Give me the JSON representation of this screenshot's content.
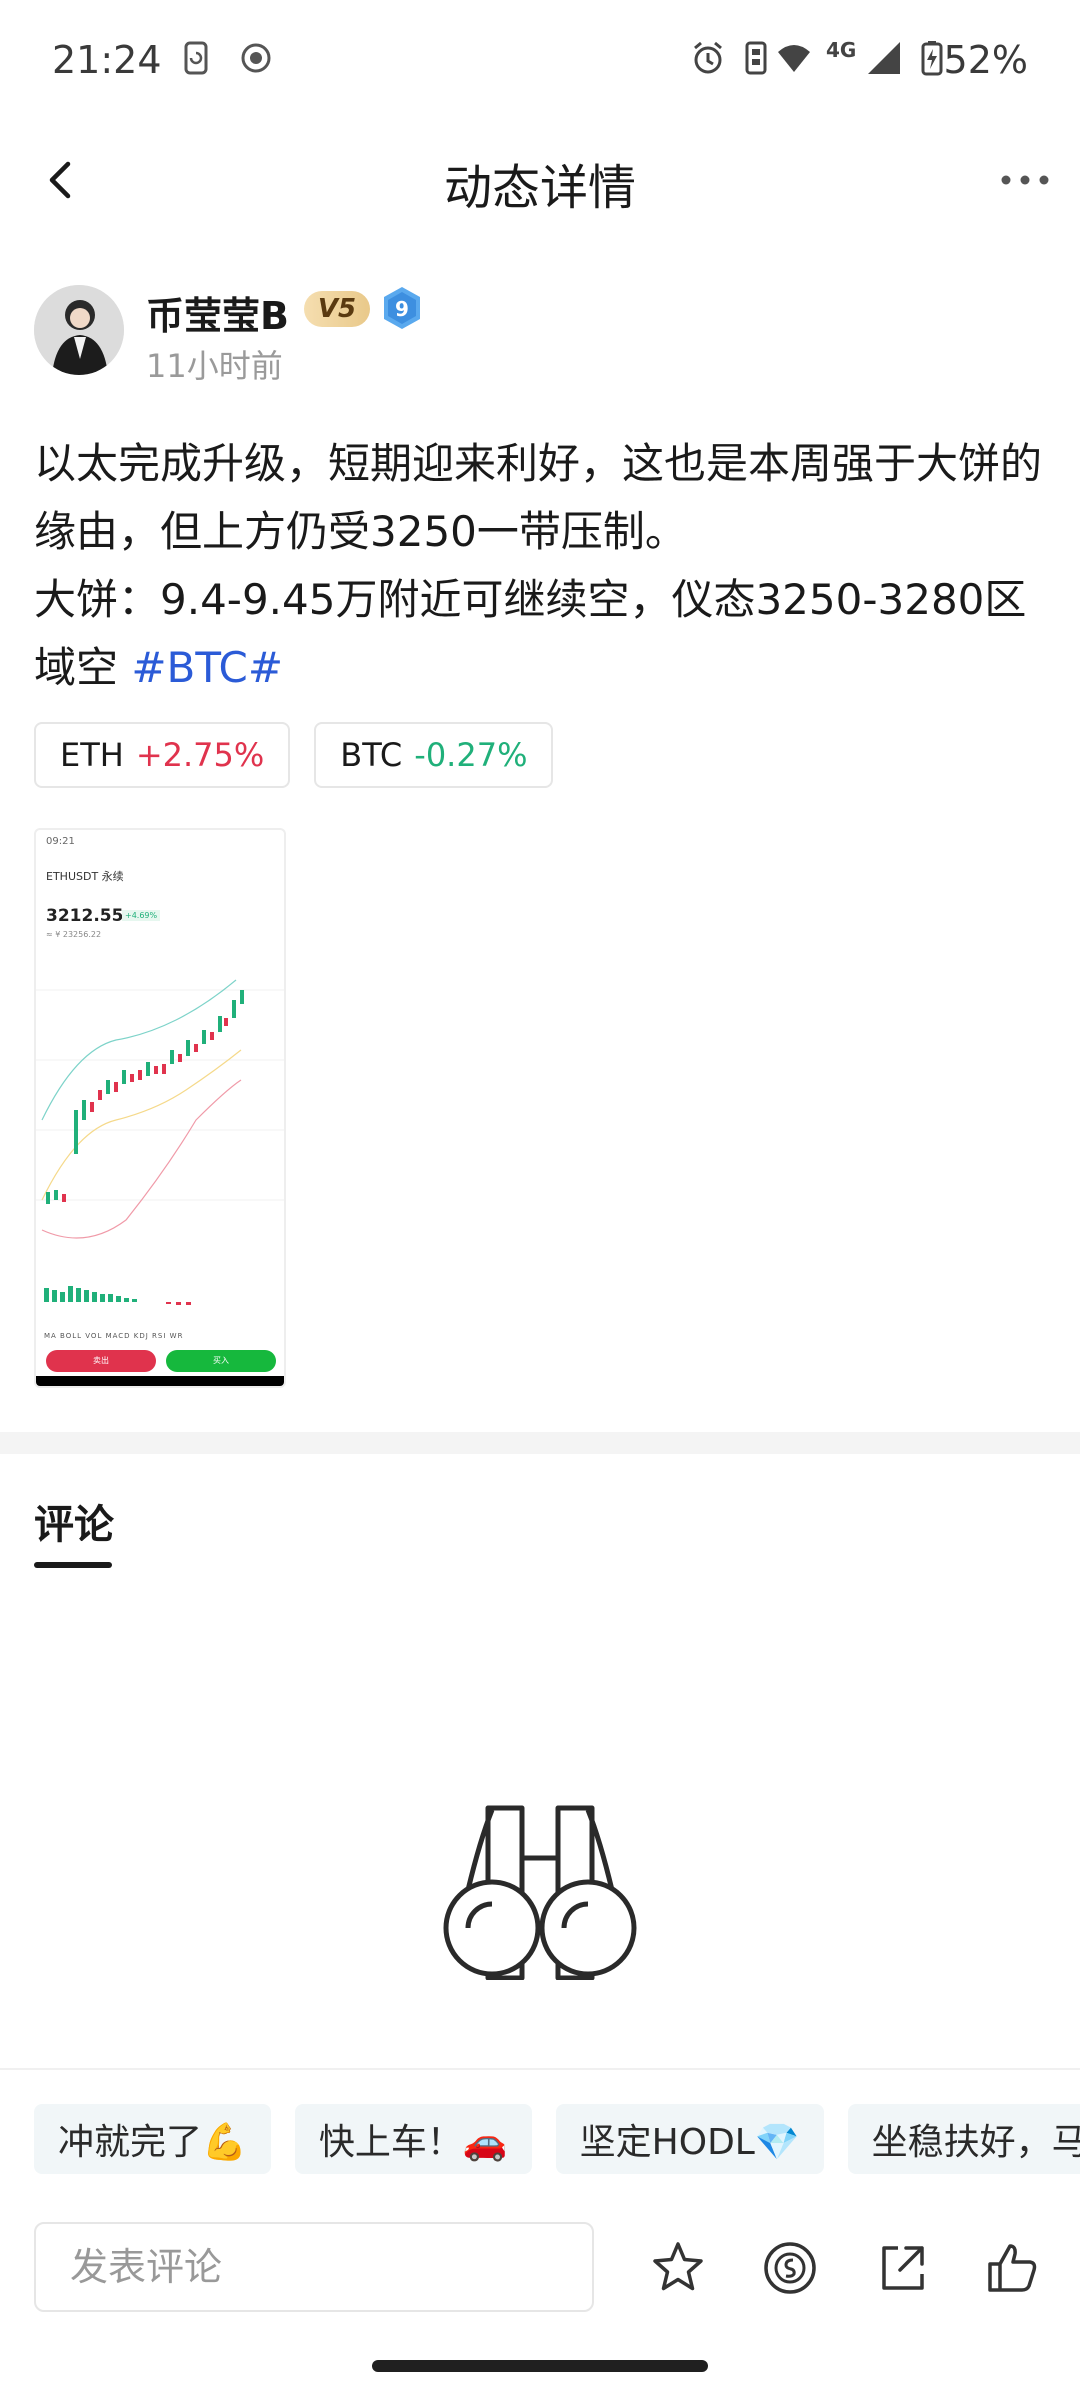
{
  "status_bar": {
    "time": "21:24",
    "battery": "52%",
    "network": "4G",
    "icons": [
      "phone-sync-icon",
      "record-icon",
      "alarm-icon",
      "vibrate-icon",
      "wifi-icon",
      "signal-icon",
      "battery-icon"
    ]
  },
  "header": {
    "title": "动态详情",
    "back_icon": "chevron-left-icon",
    "more_icon": "more-dots-icon"
  },
  "author": {
    "name": "币莹莹B",
    "vip": "V5",
    "level": "9",
    "time": "11小时前"
  },
  "post": {
    "line1": "以太完成升级，短期迎来利好，这也是本周强于大饼的缘由，但上方仍受3250一带压制。",
    "line2_prefix": "大饼：9.4-9.45万附近可继续空，仪态3250-3280区域空 ",
    "hashtag": "#BTC#"
  },
  "coins": [
    {
      "name": "ETH",
      "change": "+2.75%"
    },
    {
      "name": "BTC",
      "change": "-0.27%"
    }
  ],
  "thumbnail": {
    "time": "09:21",
    "pair": "ETHUSDT 永续",
    "price": "3212.55",
    "change": "+4.69%",
    "fiat": "≈ ¥ 23256.22",
    "tabs": "MA  BOLL  VOL  MACD  KDJ  RSI  WR",
    "sell": "卖出",
    "buy": "买入"
  },
  "comments": {
    "tab_label": "评论",
    "empty_icon": "binoculars-icon"
  },
  "quick_replies": [
    "冲就完了💪",
    "快上车！🚗",
    "坚定HODL💎",
    "坐稳扶好，马"
  ],
  "bottom_bar": {
    "input_placeholder": "发表评论",
    "actions": [
      "star-icon",
      "coin-tip-icon",
      "share-icon",
      "like-icon"
    ]
  },
  "colors": {
    "up": "#e0334d",
    "down": "#20b07a",
    "hashtag": "#2b5bd7"
  }
}
